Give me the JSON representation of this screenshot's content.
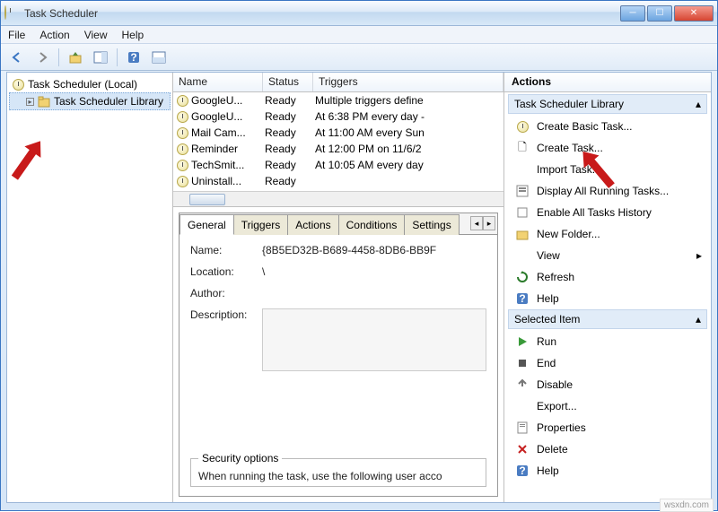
{
  "window": {
    "title": "Task Scheduler"
  },
  "menu": {
    "file": "File",
    "action": "Action",
    "view": "View",
    "help": "Help"
  },
  "tree": {
    "root": "Task Scheduler (Local)",
    "library": "Task Scheduler Library"
  },
  "columns": {
    "name": "Name",
    "status": "Status",
    "triggers": "Triggers"
  },
  "tasks": [
    {
      "name": "GoogleU...",
      "status": "Ready",
      "triggers": "Multiple triggers define"
    },
    {
      "name": "GoogleU...",
      "status": "Ready",
      "triggers": "At 6:38 PM every day - "
    },
    {
      "name": "Mail Cam...",
      "status": "Ready",
      "triggers": "At 11:00 AM every Sun"
    },
    {
      "name": "Reminder",
      "status": "Ready",
      "triggers": "At 12:00 PM on 11/6/2"
    },
    {
      "name": "TechSmit...",
      "status": "Ready",
      "triggers": "At 10:05 AM every day"
    },
    {
      "name": "Uninstall...",
      "status": "Ready",
      "triggers": ""
    }
  ],
  "tabs": {
    "general": "General",
    "triggers": "Triggers",
    "actions": "Actions",
    "conditions": "Conditions",
    "settings": "Settings"
  },
  "detail": {
    "name_label": "Name:",
    "name_value": "{8B5ED32B-B689-4458-8DB6-BB9F",
    "location_label": "Location:",
    "location_value": "\\",
    "author_label": "Author:",
    "author_value": "",
    "description_label": "Description:",
    "security_header": "Security options",
    "security_text": "When running the task, use the following user acco"
  },
  "actions_header": "Actions",
  "sections": {
    "library": "Task Scheduler Library",
    "selected": "Selected Item"
  },
  "actions_lib": {
    "create_basic": "Create Basic Task...",
    "create_task": "Create Task...",
    "import": "Import Task...",
    "display_running": "Display All Running Tasks...",
    "enable_history": "Enable All Tasks History",
    "new_folder": "New Folder...",
    "view": "View",
    "refresh": "Refresh",
    "help": "Help"
  },
  "actions_sel": {
    "run": "Run",
    "end": "End",
    "disable": "Disable",
    "export": "Export...",
    "properties": "Properties",
    "delete": "Delete",
    "help": "Help"
  },
  "watermark": "wsxdn.com"
}
